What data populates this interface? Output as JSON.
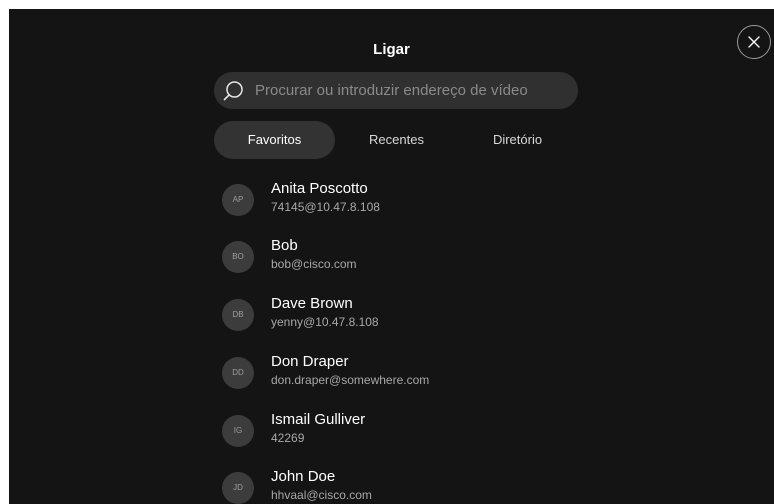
{
  "dialog": {
    "title": "Ligar",
    "close_icon": "close-icon"
  },
  "search": {
    "icon": "search-icon",
    "placeholder": "Procurar ou introduzir endereço de vídeo"
  },
  "tabs": [
    {
      "label": "Favoritos",
      "active": true
    },
    {
      "label": "Recentes",
      "active": false
    },
    {
      "label": "Diretório",
      "active": false
    }
  ],
  "contacts": [
    {
      "initials": "AP",
      "name": "Anita Poscotto",
      "address": "74145@10.47.8.108"
    },
    {
      "initials": "BO",
      "name": "Bob",
      "address": "bob@cisco.com"
    },
    {
      "initials": "DB",
      "name": "Dave Brown",
      "address": "yenny@10.47.8.108"
    },
    {
      "initials": "DD",
      "name": "Don Draper",
      "address": "don.draper@somewhere.com"
    },
    {
      "initials": "IG",
      "name": "Ismail Gulliver",
      "address": "42269"
    },
    {
      "initials": "JD",
      "name": "John Doe",
      "address": "hhvaal@cisco.com"
    }
  ],
  "colors": {
    "background": "#141414",
    "surface": "#303030",
    "text_primary": "#ffffff",
    "text_secondary": "#a8a8a8"
  }
}
